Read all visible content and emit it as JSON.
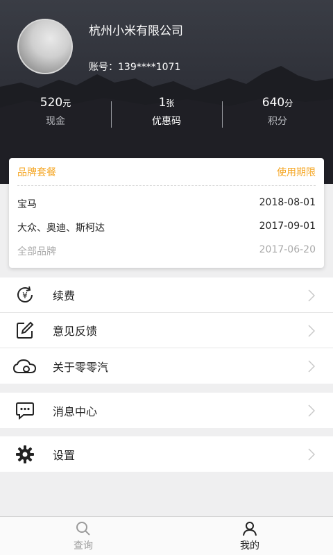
{
  "profile": {
    "company": "杭州小米有限公司",
    "account": "账号：139****1071"
  },
  "stats": [
    {
      "value": "520",
      "unit": "元",
      "label": "现金"
    },
    {
      "value": "1",
      "unit": "张",
      "label": "优惠码"
    },
    {
      "value": "640",
      "unit": "分",
      "label": "积分"
    }
  ],
  "brand_card": {
    "header_left": "品牌套餐",
    "header_right": "使用期限",
    "rows": [
      {
        "name": "宝马",
        "date": "2018-08-01"
      },
      {
        "name": "大众、奥迪、斯柯达",
        "date": "2017-09-01"
      },
      {
        "name": "全部品牌",
        "date": "2017-06-20"
      }
    ]
  },
  "menu": {
    "renew": "续费",
    "feedback": "意见反馈",
    "about": "关于零零汽",
    "messages": "消息中心",
    "settings": "设置"
  },
  "tabbar": {
    "query": "查询",
    "mine": "我的"
  },
  "colors": {
    "accent": "#f5a623",
    "header_dark": "#2f3139"
  }
}
